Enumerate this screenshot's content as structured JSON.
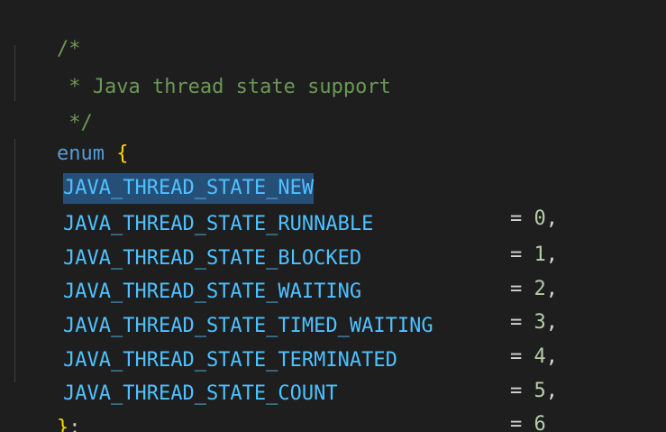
{
  "code": {
    "comment_open": "/*",
    "comment_body": " * Java thread state support",
    "comment_close": " */",
    "keyword": "enum",
    "open_brace": "{",
    "close_brace": "}",
    "terminator": ";",
    "selected_member": "JAVA_THREAD_STATE_NEW",
    "members": [
      {
        "name": "JAVA_THREAD_STATE_NEW",
        "value": "0",
        "sep": ","
      },
      {
        "name": "JAVA_THREAD_STATE_RUNNABLE",
        "value": "1",
        "sep": ","
      },
      {
        "name": "JAVA_THREAD_STATE_BLOCKED",
        "value": "2",
        "sep": ","
      },
      {
        "name": "JAVA_THREAD_STATE_WAITING",
        "value": "3",
        "sep": ","
      },
      {
        "name": "JAVA_THREAD_STATE_TIMED_WAITING",
        "value": "4",
        "sep": ","
      },
      {
        "name": "JAVA_THREAD_STATE_TERMINATED",
        "value": "5",
        "sep": ","
      },
      {
        "name": "JAVA_THREAD_STATE_COUNT",
        "value": "6",
        "sep": ""
      }
    ]
  },
  "colors": {
    "background": "#1e1e1e",
    "comment": "#6a9955",
    "keyword": "#569cd6",
    "enum_member": "#4fc1ff",
    "number": "#b5cea8",
    "selection": "#264f78"
  }
}
